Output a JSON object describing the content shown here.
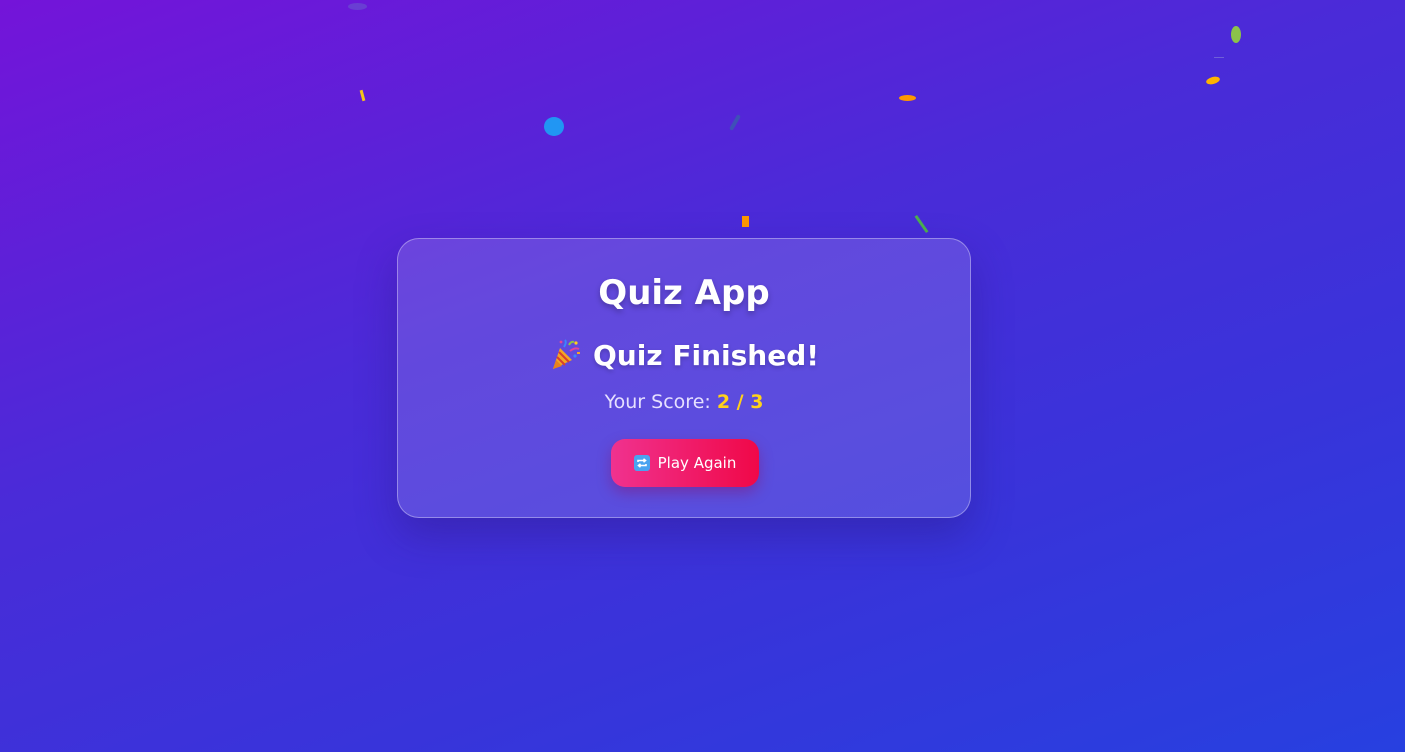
{
  "app": {
    "title": "Quiz App"
  },
  "result": {
    "icon": "party-popper-icon",
    "heading": "Quiz Finished!",
    "score_label": "Your Score:",
    "score_value": "2 / 3"
  },
  "actions": {
    "play_again_icon": "repeat-icon",
    "play_again_label": "Play Again"
  },
  "colors": {
    "background_start": "#7414d9",
    "background_end": "#2740e0",
    "score_highlight": "#ffd21a",
    "button_start": "#f0328f",
    "button_end": "#f00848",
    "confetti": [
      "#f5c518",
      "#2196f3",
      "#ff9800",
      "#8bc34a",
      "#4caf50",
      "#ffb300"
    ]
  }
}
